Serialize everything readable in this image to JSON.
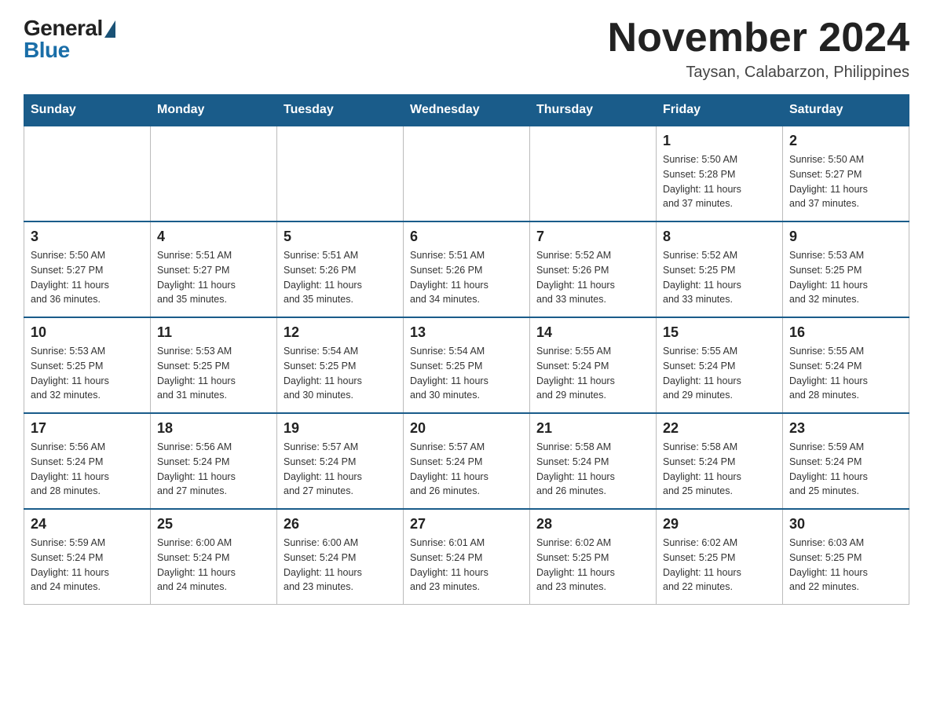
{
  "logo": {
    "general": "General",
    "blue": "Blue"
  },
  "header": {
    "month": "November 2024",
    "location": "Taysan, Calabarzon, Philippines"
  },
  "weekdays": [
    "Sunday",
    "Monday",
    "Tuesday",
    "Wednesday",
    "Thursday",
    "Friday",
    "Saturday"
  ],
  "weeks": [
    [
      {
        "day": "",
        "info": ""
      },
      {
        "day": "",
        "info": ""
      },
      {
        "day": "",
        "info": ""
      },
      {
        "day": "",
        "info": ""
      },
      {
        "day": "",
        "info": ""
      },
      {
        "day": "1",
        "info": "Sunrise: 5:50 AM\nSunset: 5:28 PM\nDaylight: 11 hours\nand 37 minutes."
      },
      {
        "day": "2",
        "info": "Sunrise: 5:50 AM\nSunset: 5:27 PM\nDaylight: 11 hours\nand 37 minutes."
      }
    ],
    [
      {
        "day": "3",
        "info": "Sunrise: 5:50 AM\nSunset: 5:27 PM\nDaylight: 11 hours\nand 36 minutes."
      },
      {
        "day": "4",
        "info": "Sunrise: 5:51 AM\nSunset: 5:27 PM\nDaylight: 11 hours\nand 35 minutes."
      },
      {
        "day": "5",
        "info": "Sunrise: 5:51 AM\nSunset: 5:26 PM\nDaylight: 11 hours\nand 35 minutes."
      },
      {
        "day": "6",
        "info": "Sunrise: 5:51 AM\nSunset: 5:26 PM\nDaylight: 11 hours\nand 34 minutes."
      },
      {
        "day": "7",
        "info": "Sunrise: 5:52 AM\nSunset: 5:26 PM\nDaylight: 11 hours\nand 33 minutes."
      },
      {
        "day": "8",
        "info": "Sunrise: 5:52 AM\nSunset: 5:25 PM\nDaylight: 11 hours\nand 33 minutes."
      },
      {
        "day": "9",
        "info": "Sunrise: 5:53 AM\nSunset: 5:25 PM\nDaylight: 11 hours\nand 32 minutes."
      }
    ],
    [
      {
        "day": "10",
        "info": "Sunrise: 5:53 AM\nSunset: 5:25 PM\nDaylight: 11 hours\nand 32 minutes."
      },
      {
        "day": "11",
        "info": "Sunrise: 5:53 AM\nSunset: 5:25 PM\nDaylight: 11 hours\nand 31 minutes."
      },
      {
        "day": "12",
        "info": "Sunrise: 5:54 AM\nSunset: 5:25 PM\nDaylight: 11 hours\nand 30 minutes."
      },
      {
        "day": "13",
        "info": "Sunrise: 5:54 AM\nSunset: 5:25 PM\nDaylight: 11 hours\nand 30 minutes."
      },
      {
        "day": "14",
        "info": "Sunrise: 5:55 AM\nSunset: 5:24 PM\nDaylight: 11 hours\nand 29 minutes."
      },
      {
        "day": "15",
        "info": "Sunrise: 5:55 AM\nSunset: 5:24 PM\nDaylight: 11 hours\nand 29 minutes."
      },
      {
        "day": "16",
        "info": "Sunrise: 5:55 AM\nSunset: 5:24 PM\nDaylight: 11 hours\nand 28 minutes."
      }
    ],
    [
      {
        "day": "17",
        "info": "Sunrise: 5:56 AM\nSunset: 5:24 PM\nDaylight: 11 hours\nand 28 minutes."
      },
      {
        "day": "18",
        "info": "Sunrise: 5:56 AM\nSunset: 5:24 PM\nDaylight: 11 hours\nand 27 minutes."
      },
      {
        "day": "19",
        "info": "Sunrise: 5:57 AM\nSunset: 5:24 PM\nDaylight: 11 hours\nand 27 minutes."
      },
      {
        "day": "20",
        "info": "Sunrise: 5:57 AM\nSunset: 5:24 PM\nDaylight: 11 hours\nand 26 minutes."
      },
      {
        "day": "21",
        "info": "Sunrise: 5:58 AM\nSunset: 5:24 PM\nDaylight: 11 hours\nand 26 minutes."
      },
      {
        "day": "22",
        "info": "Sunrise: 5:58 AM\nSunset: 5:24 PM\nDaylight: 11 hours\nand 25 minutes."
      },
      {
        "day": "23",
        "info": "Sunrise: 5:59 AM\nSunset: 5:24 PM\nDaylight: 11 hours\nand 25 minutes."
      }
    ],
    [
      {
        "day": "24",
        "info": "Sunrise: 5:59 AM\nSunset: 5:24 PM\nDaylight: 11 hours\nand 24 minutes."
      },
      {
        "day": "25",
        "info": "Sunrise: 6:00 AM\nSunset: 5:24 PM\nDaylight: 11 hours\nand 24 minutes."
      },
      {
        "day": "26",
        "info": "Sunrise: 6:00 AM\nSunset: 5:24 PM\nDaylight: 11 hours\nand 23 minutes."
      },
      {
        "day": "27",
        "info": "Sunrise: 6:01 AM\nSunset: 5:24 PM\nDaylight: 11 hours\nand 23 minutes."
      },
      {
        "day": "28",
        "info": "Sunrise: 6:02 AM\nSunset: 5:25 PM\nDaylight: 11 hours\nand 23 minutes."
      },
      {
        "day": "29",
        "info": "Sunrise: 6:02 AM\nSunset: 5:25 PM\nDaylight: 11 hours\nand 22 minutes."
      },
      {
        "day": "30",
        "info": "Sunrise: 6:03 AM\nSunset: 5:25 PM\nDaylight: 11 hours\nand 22 minutes."
      }
    ]
  ]
}
